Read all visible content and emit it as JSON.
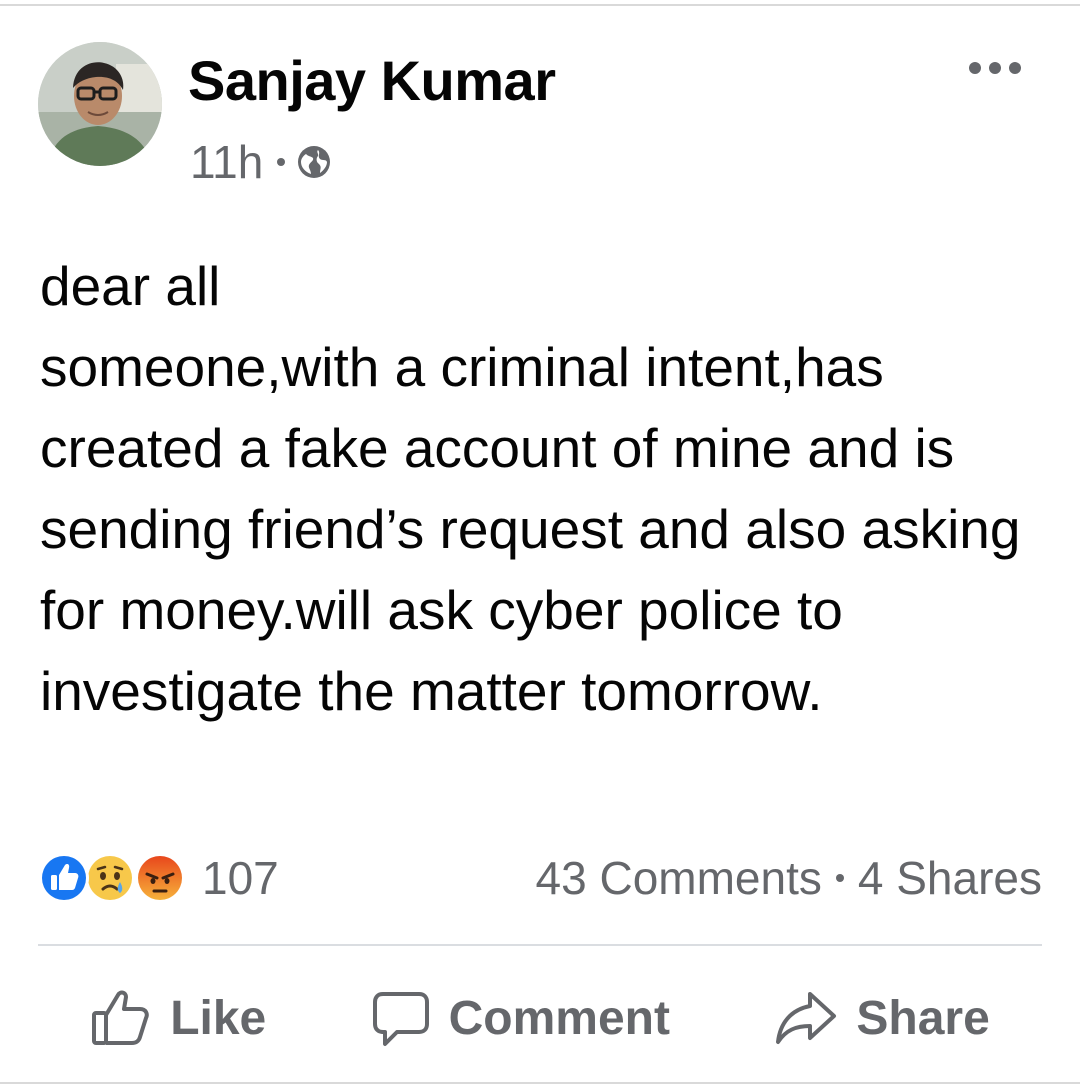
{
  "post": {
    "author": "Sanjay Kumar",
    "time": "11h",
    "privacy_icon": "globe-icon",
    "more_icon": "more-options-icon",
    "text": "dear all\nsomeone,with a criminal intent,has created a fake account of mine and is sending friend’s request and also asking  for money.will ask cyber police to investigate the matter tomorrow."
  },
  "stats": {
    "reaction_icons": [
      "like-reaction-icon",
      "sad-reaction-icon",
      "angry-reaction-icon"
    ],
    "reaction_count": "107",
    "comments": "43 Comments",
    "shares": "4 Shares"
  },
  "actions": {
    "like_label": "Like",
    "comment_label": "Comment",
    "share_label": "Share"
  },
  "colors": {
    "like_blue": "#1877f2",
    "secondary_text": "#65676b",
    "primary_text": "#050505"
  }
}
